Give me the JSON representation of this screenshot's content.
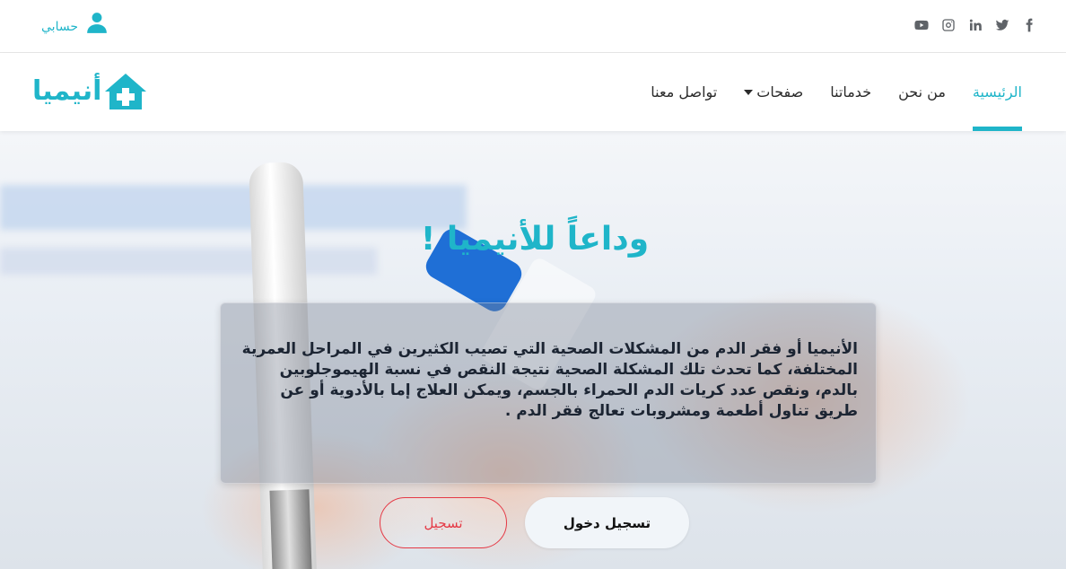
{
  "topbar": {
    "account_label": "حسابي",
    "account_icon": "user-icon",
    "socials": [
      {
        "name": "facebook-icon"
      },
      {
        "name": "twitter-icon"
      },
      {
        "name": "linkedin-icon"
      },
      {
        "name": "instagram-icon"
      },
      {
        "name": "youtube-icon"
      }
    ]
  },
  "nav": {
    "logo_text": "أنيميا",
    "logo_icon": "house-medical-icon",
    "items": [
      {
        "label": "الرئيسية",
        "active": true
      },
      {
        "label": "من نحن"
      },
      {
        "label": "خدماتنا"
      },
      {
        "label": "صفحات",
        "has_dropdown": true
      },
      {
        "label": "تواصل معنا"
      }
    ]
  },
  "hero": {
    "title": "وداعاً للأنيميا !",
    "text": "الأنيميا أو فقر الدم من المشكلات الصحية التي تصيب الكثيرين في المراحل العمرية المختلفة، كما تحدث تلك المشكلة الصحية نتيجة النقص في نسبة الهيموجلوبين بالدم، ونقص عدد كريات الدم الحمراء بالجسم، ويمكن العلاج إما بالأدوية أو عن طريق تناول أطعمة ومشروبات تعالج فقر الدم .",
    "login_label": "تسجيل دخول",
    "register_label": "تسجيل"
  },
  "colors": {
    "accent": "#1fb5c9",
    "danger": "#e53945"
  }
}
